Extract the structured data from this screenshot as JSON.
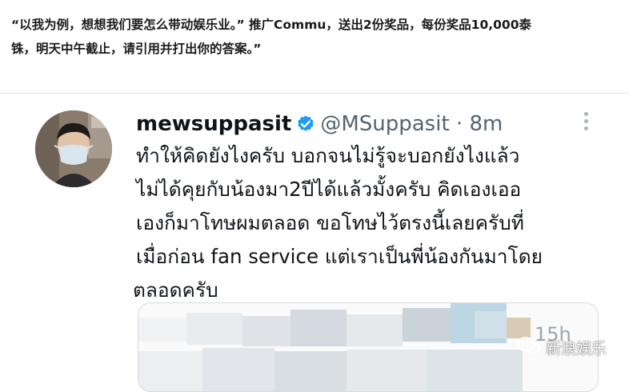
{
  "caption": {
    "line1": "“以我为例，想想我们要怎么带动娱乐业。” 推广Commu，送出2份奖品，每份奖品10,000泰",
    "line2": "铢，明天中午截止，请引用并打出你的答案。”"
  },
  "tweet": {
    "display_name": "mewsuppasit",
    "handle": "@MSuppasit",
    "separator": "·",
    "time": "8m",
    "lines": [
      "ทำให้คิดยังไงครับ บอกจนไม่รู้จะบอกยังไงแล้ว",
      "ไม่ได้คุยกับน้องมา2ปีได้แล้วมั้งครับ คิดเองเออ",
      "เองก็มาโทษผมตลอด ขอโทษไว้ตรงนี้เลยครับที่",
      "เมื่อก่อน fan service แต่เราเป็นพี่น้องกันมาโดย",
      "ตลอดครับ"
    ]
  },
  "quoted_tweet": {
    "time": "15h"
  },
  "watermark": {
    "text": "新浪娱乐"
  },
  "colors": {
    "verified": "#1d9bf0",
    "secondary_text": "#536471",
    "border": "#d6dde3"
  }
}
